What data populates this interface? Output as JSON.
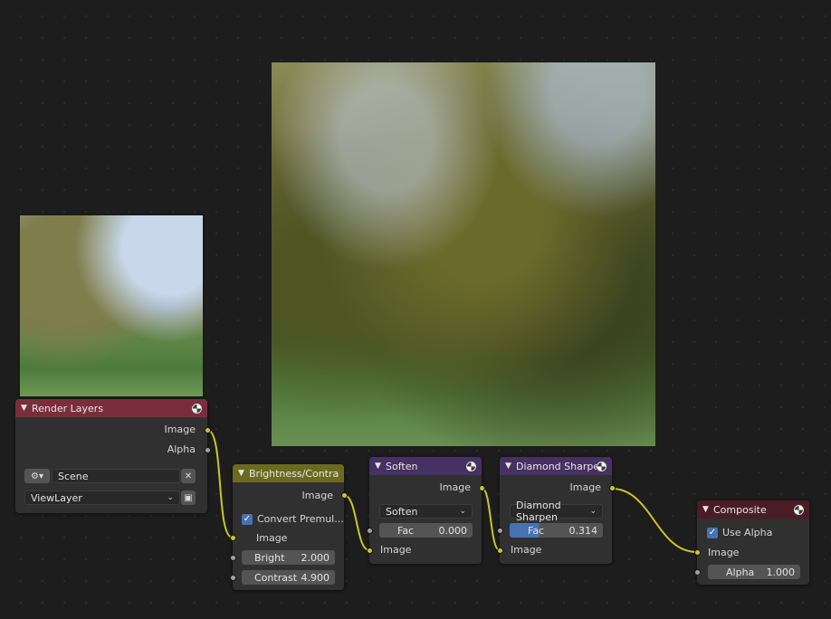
{
  "colors": {
    "render_layers_header": "#7a2e3b",
    "color_header": "#6b6b1f",
    "filter_header": "#463163",
    "output_header": "#4a1d26",
    "link": "#c7c729",
    "accent": "#4772b3"
  },
  "nodes": {
    "render_layers": {
      "title": "Render Layers",
      "outputs": [
        "Image",
        "Alpha"
      ],
      "scene": "Scene",
      "view_layer": "ViewLayer"
    },
    "brightness_contrast": {
      "title": "Brightness/Contrast",
      "output": "Image",
      "convert_label": "Convert Premul...",
      "convert_checked": true,
      "input": "Image",
      "bright_label": "Bright",
      "bright_value": "2.000",
      "contrast_label": "Contrast",
      "contrast_value": "4.900"
    },
    "soften": {
      "title": "Soften",
      "output": "Image",
      "mode": "Soften",
      "fac_label": "Fac",
      "fac_value": "0.000",
      "input": "Image"
    },
    "diamond_sharpen": {
      "title": "Diamond Sharpen",
      "output": "Image",
      "mode": "Diamond Sharpen",
      "fac_label": "Fac",
      "fac_value": "0.314",
      "fac_fraction": 0.314,
      "input": "Image"
    },
    "composite": {
      "title": "Composite",
      "use_alpha_label": "Use Alpha",
      "use_alpha_checked": true,
      "input": "Image",
      "alpha_label": "Alpha",
      "alpha_value": "1.000"
    }
  },
  "icons": {
    "preview_sphere": "sphere-icon",
    "collapse": "chevron-down-icon",
    "scene_browse": "scene-icon",
    "clear": "close-icon",
    "view_layer_browse": "folder-icon",
    "checkbox": "checkmark-icon"
  }
}
